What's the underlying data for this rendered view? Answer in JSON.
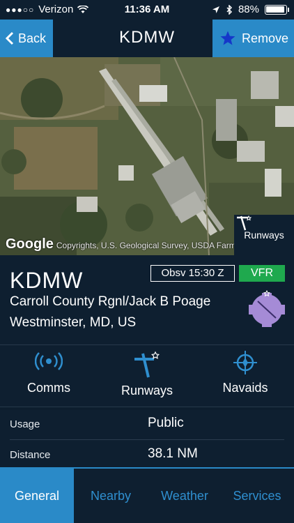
{
  "statusbar": {
    "carrier": "Verizon",
    "signal": "●●●○○",
    "time": "11:36 AM",
    "battery": "88%",
    "battery_level": 0.88
  },
  "navbar": {
    "back_label": "Back",
    "title": "KDMW",
    "remove_label": "Remove"
  },
  "map": {
    "google_label": "Google",
    "attribution": "Copyrights, U.S. Geological Survey, USDA Farm Ser",
    "runways_label": "Runways"
  },
  "airport": {
    "code": "KDMW",
    "name": "Carroll County Rgnl/Jack B Poage",
    "city": "Westminster, MD, US",
    "observation": "Obsv 15:30 Z",
    "flight_category": "VFR"
  },
  "actions": [
    {
      "label": "Comms",
      "icon": "radio-broadcast-icon"
    },
    {
      "label": "Runways",
      "icon": "runway-icon"
    },
    {
      "label": "Navaids",
      "icon": "navaid-icon"
    }
  ],
  "details": [
    {
      "key": "Usage",
      "value": "Public"
    },
    {
      "key": "Distance",
      "value": "38.1 NM"
    }
  ],
  "tabs": [
    {
      "label": "General",
      "active": true
    },
    {
      "label": "Nearby",
      "active": false
    },
    {
      "label": "Weather",
      "active": false
    },
    {
      "label": "Services",
      "active": false
    }
  ],
  "colors": {
    "accent": "#2a8ac8",
    "background": "#0e1f30",
    "vfr": "#1fa94e",
    "wind_badge": "#a58bd6"
  }
}
